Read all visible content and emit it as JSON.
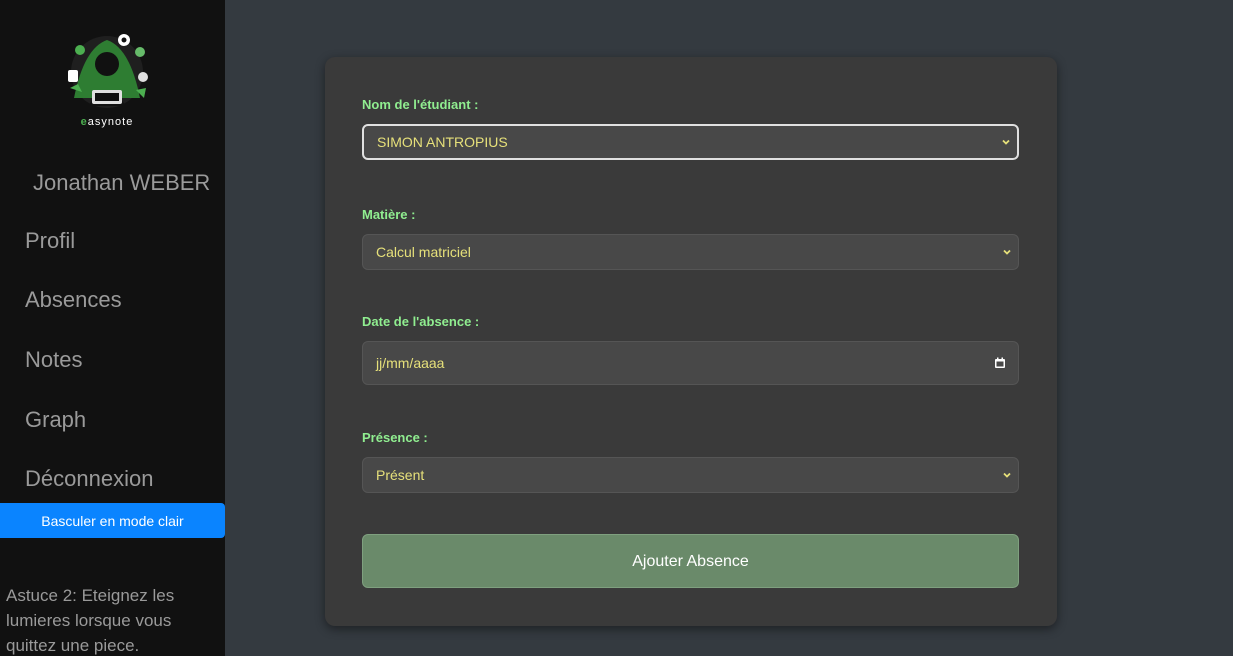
{
  "sidebar": {
    "logo_text_accent": "e",
    "logo_text_rest": "asynote",
    "user_name": "Jonathan WEBER",
    "nav": [
      {
        "label": "Profil"
      },
      {
        "label": "Absences"
      },
      {
        "label": "Notes"
      },
      {
        "label": "Graph"
      },
      {
        "label": "Déconnexion"
      }
    ],
    "mode_button": "Basculer en mode clair",
    "tip": "Astuce 2: Eteignez les lumieres lorsque vous quittez une piece."
  },
  "form": {
    "student_label": "Nom de l'étudiant :",
    "student_value": "SIMON ANTROPIUS",
    "subject_label": "Matière :",
    "subject_value": "Calcul matriciel",
    "date_label": "Date de l'absence :",
    "date_value": "jj/mm/aaaa",
    "presence_label": "Présence :",
    "presence_value": "Présent",
    "submit_label": "Ajouter Absence"
  },
  "colors": {
    "background": "#343a40",
    "sidebar": "#111111",
    "card": "#3a3a3a",
    "label": "#90ee90",
    "field_text": "#e6e07a",
    "mode_button": "#0a84ff",
    "submit": "#6a8a6a"
  },
  "icons": {
    "logo": "easynote-logo",
    "select_arrow": "chevron-down-icon",
    "date_picker": "calendar-icon"
  }
}
